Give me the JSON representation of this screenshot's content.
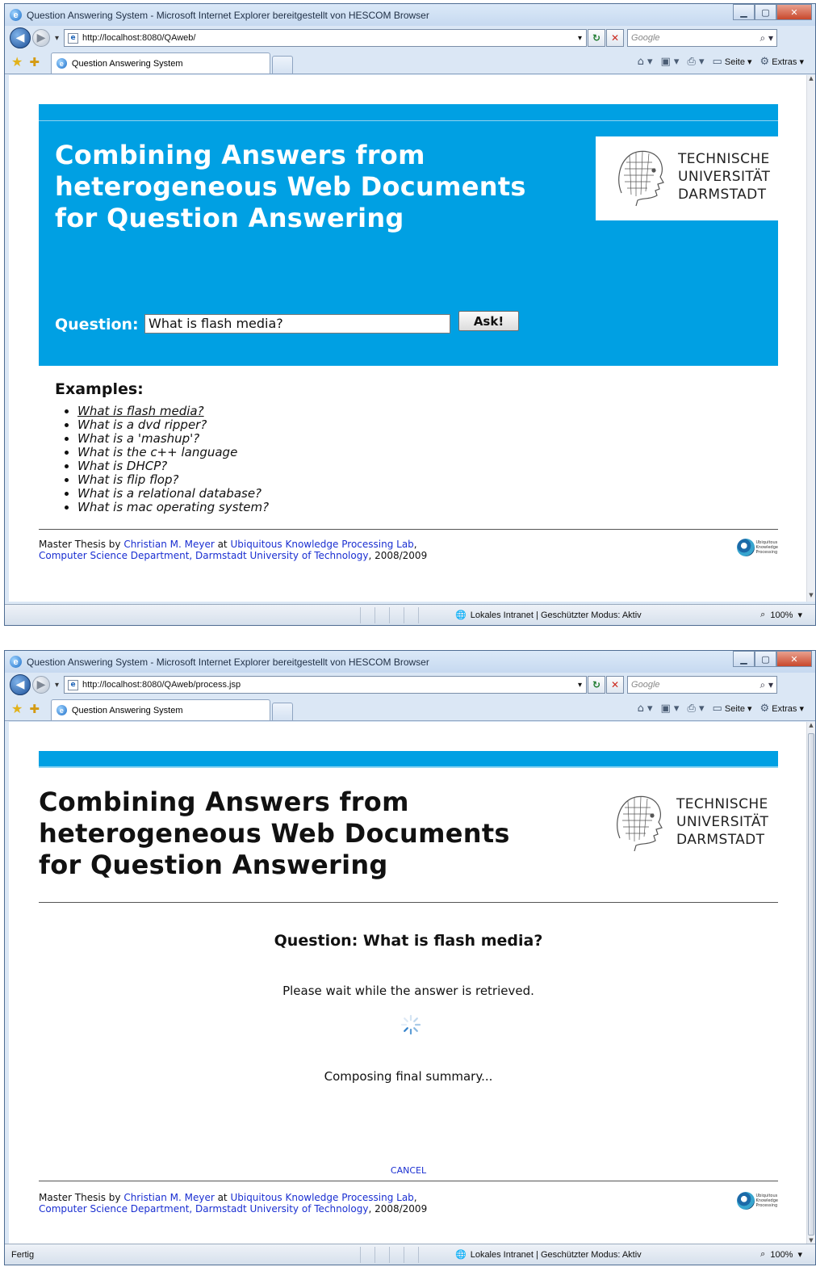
{
  "window1": {
    "window_title": "Question Answering System - Microsoft Internet Explorer bereitgestellt von HESCOM Browser",
    "address": "http://localhost:8080/QAweb/",
    "search_placeholder": "Google",
    "tab_label": "Question Answering System",
    "commands": {
      "page": "Seite",
      "tools": "Extras"
    },
    "status": {
      "left": "",
      "zone": "Lokales Intranet | Geschützter Modus: Aktiv",
      "zoom": "100%"
    }
  },
  "window2": {
    "window_title": "Question Answering System - Microsoft Internet Explorer bereitgestellt von HESCOM Browser",
    "address": "http://localhost:8080/QAweb/process.jsp",
    "search_placeholder": "Google",
    "tab_label": "Question Answering System",
    "commands": {
      "page": "Seite",
      "tools": "Extras"
    },
    "status": {
      "left": "Fertig",
      "zone": "Lokales Intranet | Geschützter Modus: Aktiv",
      "zoom": "100%"
    }
  },
  "page": {
    "title_lines": [
      "Combining Answers from",
      "heterogeneous Web Documents",
      "for Question Answering"
    ],
    "logo_lines": [
      "TECHNISCHE",
      "UNIVERSITÄT",
      "DARMSTADT"
    ],
    "question_label": "Question:",
    "question_value": "What is flash media?",
    "ask_button": "Ask!",
    "examples_heading": "Examples:",
    "examples": [
      "What is flash media?",
      "What is a dvd ripper?",
      "What is a 'mashup'?",
      "What is the c++ language",
      "What is DHCP?",
      "What is flip flop?",
      "What is a relational database?",
      "What is mac operating system?"
    ],
    "footer": {
      "prefix": "Master Thesis by ",
      "author": "Christian M. Meyer",
      "at": " at ",
      "lab": "Ubiquitous Knowledge Processing Lab",
      "comma": ",",
      "dept": "Computer Science Department, Darmstadt University of Technology",
      "year": ", 2008/2009",
      "ukp_lines": [
        "Ubiquitous",
        "Knowledge",
        "Processing"
      ]
    }
  },
  "process": {
    "question_heading": "Question: What is flash media?",
    "wait_text": "Please wait while the answer is retrieved.",
    "status_text": "Composing final summary...",
    "cancel_label": "CANCEL"
  },
  "colors": {
    "brand_blue": "#00a0e3",
    "link_blue": "#1a2fd1"
  }
}
